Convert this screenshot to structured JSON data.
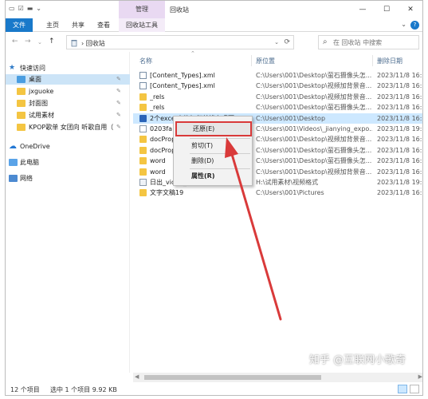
{
  "titlebar": {
    "manage_tab": "管理",
    "title": "回收站",
    "minimize": "—",
    "maximize": "☐",
    "close": "✕"
  },
  "ribbon": {
    "file": "文件",
    "home": "主页",
    "share": "共享",
    "view": "查看",
    "tools": "回收站工具"
  },
  "address": {
    "crumb_sep": "›",
    "location": "回收站",
    "search_placeholder": "在 回收站 中搜索"
  },
  "sidebar": {
    "items": [
      {
        "label": "快速访问",
        "icon": "star"
      },
      {
        "label": "桌面",
        "icon": "folder-blue",
        "pinned": true
      },
      {
        "label": "jxguoke",
        "icon": "folder",
        "pinned": true
      },
      {
        "label": "封面图",
        "icon": "folder",
        "pinned": true
      },
      {
        "label": "试用素材",
        "icon": "folder",
        "pinned": true
      },
      {
        "label": "KPOP歌单 女团向 听歌自用（",
        "icon": "folder",
        "pinned": true
      },
      {
        "label": "OneDrive",
        "icon": "cloud"
      },
      {
        "label": "此电脑",
        "icon": "pc"
      },
      {
        "label": "网络",
        "icon": "net"
      }
    ]
  },
  "columns": {
    "name": "名称",
    "location": "原位置",
    "deleted": "删除日期"
  },
  "files": [
    {
      "name": "[Content_Types].xml",
      "loc": "C:\\Users\\001\\Desktop\\萤石摄像头怎...",
      "date": "2023/11/8 16:10",
      "type": "xml"
    },
    {
      "name": "[Content_Types].xml",
      "loc": "C:\\Users\\001\\Desktop\\视频加背景音...",
      "date": "2023/11/8 16:50",
      "type": "xml"
    },
    {
      "name": "_rels",
      "loc": "C:\\Users\\001\\Desktop\\视频加背景音...",
      "date": "2023/11/8 16:50",
      "type": "folder"
    },
    {
      "name": "_rels",
      "loc": "C:\\Users\\001\\Desktop\\萤石摄像头怎...",
      "date": "2023/11/8 16:10",
      "type": "folder"
    },
    {
      "name": "2个excel表格如何并排在桌面.docx",
      "loc": "C:\\Users\\001\\Desktop",
      "date": "2023/11/8 16:56",
      "type": "docx"
    },
    {
      "name": "0203fa",
      "loc": "C:\\Users\\001\\Videos\\_jianying_expo...",
      "date": "2023/11/8 19:02",
      "type": "file"
    },
    {
      "name": "docProp",
      "loc": "C:\\Users\\001\\Desktop\\视频加背景音...",
      "date": "2023/11/8 16:50",
      "type": "folder"
    },
    {
      "name": "docProp",
      "loc": "C:\\Users\\001\\Desktop\\萤石摄像头怎...",
      "date": "2023/11/8 16:10",
      "type": "folder"
    },
    {
      "name": "word",
      "loc": "C:\\Users\\001\\Desktop\\萤石摄像头怎...",
      "date": "2023/11/8 16:10",
      "type": "folder"
    },
    {
      "name": "word",
      "loc": "C:\\Users\\001\\Desktop\\视频加背景音...",
      "date": "2023/11/8 16:50",
      "type": "folder"
    },
    {
      "name": "日出_video_index.mp4",
      "loc": "H:\\试用素材\\视频格式",
      "date": "2023/11/8 19:06",
      "type": "mp4"
    },
    {
      "name": "文字文稿19",
      "loc": "C:\\Users\\001\\Pictures",
      "date": "2023/11/8 16:55",
      "type": "folder"
    }
  ],
  "context_menu": {
    "restore": "还原(E)",
    "cut": "剪切(T)",
    "delete": "删除(D)",
    "properties": "属性(R)"
  },
  "status": {
    "count": "12 个项目",
    "selection": "选中 1 个项目  9.92 KB"
  },
  "watermark": "知乎 @互联网小歌奇",
  "colors": {
    "accent": "#1979ca",
    "selection": "#cde8ff",
    "manage_tab": "#e9d9f2",
    "highlight": "#d93a3a"
  }
}
